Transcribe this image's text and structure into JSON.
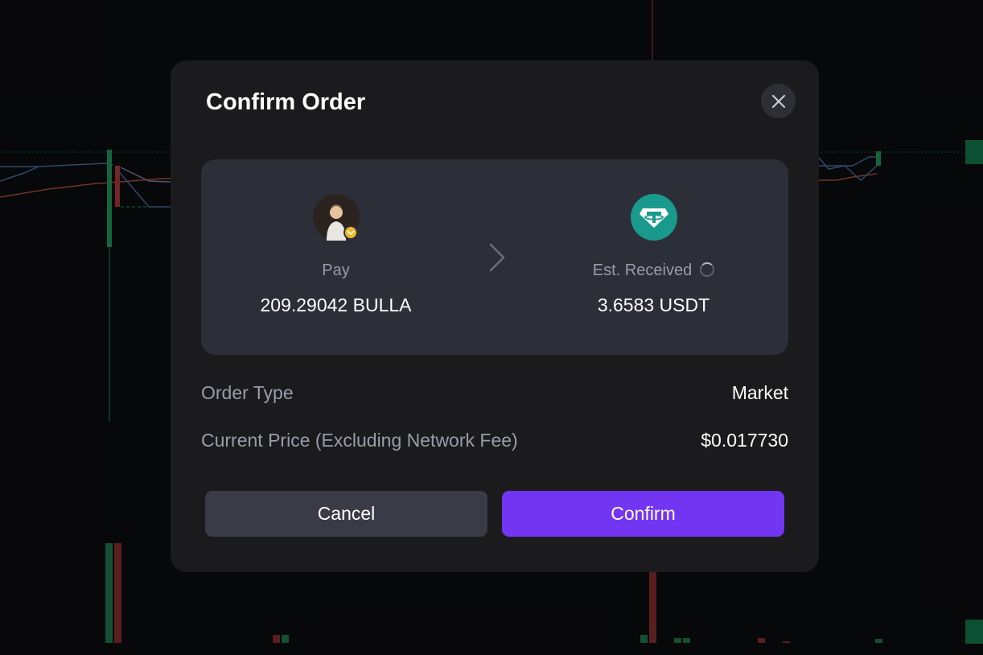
{
  "colors": {
    "accent": "#7235f2",
    "modal_bg": "#1b1b1e",
    "card_bg": "#2c2e38",
    "tether_green": "#1a9a8c",
    "candle_up": "#1f9a5e",
    "candle_down": "#b33a3a"
  },
  "dialog": {
    "title": "Confirm Order",
    "close_icon": "close-icon"
  },
  "swap": {
    "pay": {
      "label": "Pay",
      "amount": "209.29042 BULLA",
      "icon": "bulla-token-icon"
    },
    "arrow_icon": "chevron-right-icon",
    "receive": {
      "label": "Est. Received",
      "amount": "3.6583 USDT",
      "icon": "usdt-token-icon",
      "loading_icon": "spinner-icon"
    }
  },
  "details": [
    {
      "label": "Order Type",
      "value": "Market"
    },
    {
      "label": "Current Price (Excluding Network Fee)",
      "value": "$0.017730"
    }
  ],
  "buttons": {
    "cancel": "Cancel",
    "confirm": "Confirm"
  }
}
